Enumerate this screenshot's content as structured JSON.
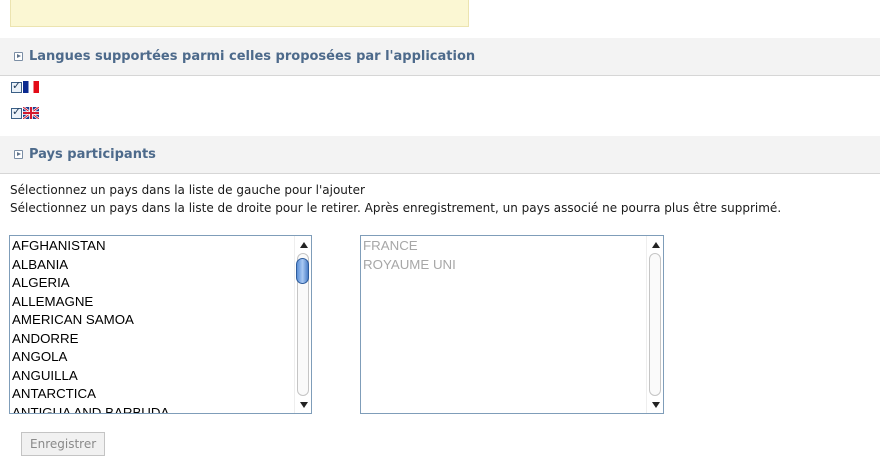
{
  "sections": {
    "languages": {
      "title": "Langues supportées parmi celles proposées par l'application",
      "items": [
        {
          "flag": "france-flag-icon",
          "checked": true
        },
        {
          "flag": "uk-flag-icon",
          "checked": true
        }
      ]
    },
    "countries": {
      "title": "Pays participants",
      "instruction_add": "Sélectionnez un pays dans la liste de gauche pour l'ajouter",
      "instruction_remove": "Sélectionnez un pays dans la liste de droite pour le retirer. Après enregistrement, un pays associé ne pourra plus être supprimé.",
      "available": [
        "AFGHANISTAN",
        "ALBANIA",
        "ALGERIA",
        "ALLEMAGNE",
        "AMERICAN SAMOA",
        "ANDORRE",
        "ANGOLA",
        "ANGUILLA",
        "ANTARCTICA",
        "ANTIGUA AND BARBUDA"
      ],
      "selected": [
        "FRANCE",
        "ROYAUME UNI"
      ]
    }
  },
  "save_button": "Enregistrer"
}
